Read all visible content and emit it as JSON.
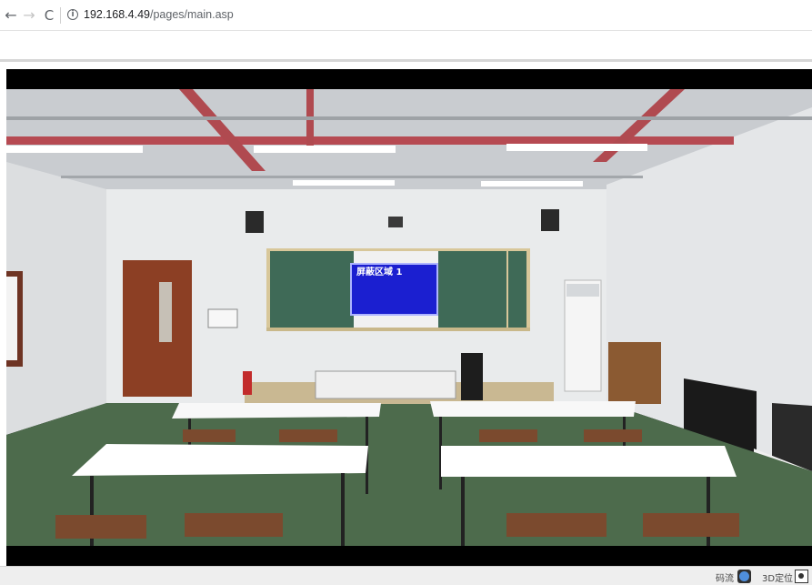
{
  "browser": {
    "back_icon": "←",
    "forward_icon": "→",
    "reload_icon": "C",
    "info_icon": "i",
    "url_host": "192.168.4.49",
    "url_path": "/pages/main.asp"
  },
  "video": {
    "privacy_mask_label": "屏蔽区域 1"
  },
  "status_bar": {
    "stream_label": "码流",
    "location_label": "3D定位"
  },
  "colors": {
    "mask": "#1b1fd0",
    "video_bg": "#000000"
  }
}
